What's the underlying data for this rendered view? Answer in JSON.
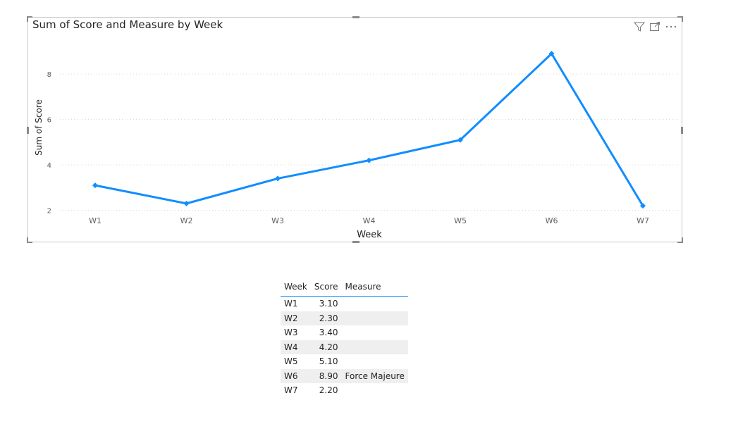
{
  "chart_data": {
    "type": "line",
    "title": "Sum of Score and Measure by Week",
    "xlabel": "Week",
    "ylabel": "Sum of Score",
    "categories": [
      "W1",
      "W2",
      "W3",
      "W4",
      "W5",
      "W6",
      "W7"
    ],
    "series": [
      {
        "values": [
          3.1,
          2.3,
          3.4,
          4.2,
          5.1,
          8.9,
          2.2
        ],
        "color": "#118dff"
      }
    ],
    "yticks": [
      2,
      4,
      6,
      8
    ],
    "ylim": [
      1.8,
      9.4
    ],
    "grid": true,
    "marker": "diamond"
  },
  "toolbar": {
    "icons": [
      "filter-icon",
      "focus-mode-icon",
      "more-options-icon"
    ]
  },
  "table": {
    "headers": [
      "Week",
      "Score",
      "Measure"
    ],
    "rows": [
      [
        "W1",
        "3.10",
        ""
      ],
      [
        "W2",
        "2.30",
        ""
      ],
      [
        "W3",
        "3.40",
        ""
      ],
      [
        "W4",
        "4.20",
        ""
      ],
      [
        "W5",
        "5.10",
        ""
      ],
      [
        "W6",
        "8.90",
        "Force Majeure"
      ],
      [
        "W7",
        "2.20",
        ""
      ]
    ]
  }
}
